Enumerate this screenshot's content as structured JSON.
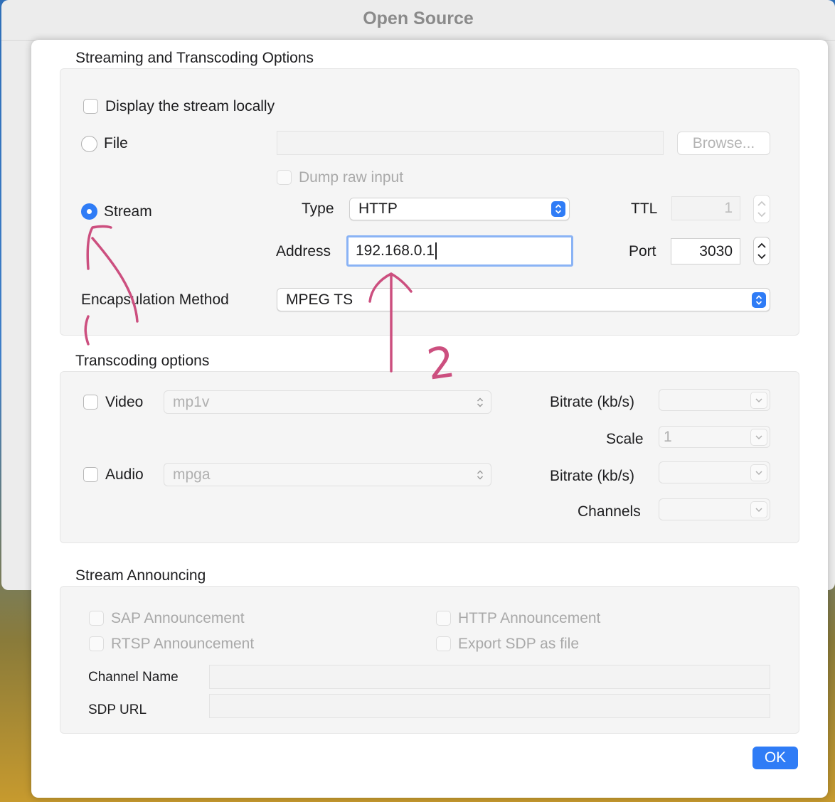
{
  "window": {
    "title": "Open Source"
  },
  "streaming": {
    "section_title": "Streaming and Transcoding Options",
    "display_locally_label": "Display the stream locally",
    "file_label": "File",
    "file_path": "",
    "browse_label": "Browse...",
    "dump_raw_label": "Dump raw input",
    "stream_label": "Stream",
    "type_label": "Type",
    "type_value": "HTTP",
    "ttl_label": "TTL",
    "ttl_value": "1",
    "address_label": "Address",
    "address_value": "192.168.0.1",
    "port_label": "Port",
    "port_value": "3030",
    "encapsulation_label": "Encapsulation Method",
    "encapsulation_value": "MPEG TS"
  },
  "transcoding": {
    "section_title": "Transcoding options",
    "video_label": "Video",
    "video_codec": "mp1v",
    "audio_label": "Audio",
    "audio_codec": "mpga",
    "video_bitrate_label": "Bitrate (kb/s)",
    "video_bitrate_value": "",
    "scale_label": "Scale",
    "scale_value": "1",
    "audio_bitrate_label": "Bitrate (kb/s)",
    "audio_bitrate_value": "",
    "channels_label": "Channels",
    "channels_value": ""
  },
  "announcing": {
    "section_title": "Stream Announcing",
    "sap_label": "SAP Announcement",
    "rtsp_label": "RTSP Announcement",
    "http_label": "HTTP Announcement",
    "export_sdp_label": "Export SDP as file",
    "channel_name_label": "Channel Name",
    "channel_name_value": "",
    "sdp_url_label": "SDP URL",
    "sdp_url_value": ""
  },
  "footer": {
    "ok_label": "OK"
  },
  "annotation": {
    "number_label": "2",
    "color": "#cc4f7f"
  },
  "colors": {
    "accent": "#2f7cf6",
    "focus_ring": "#8ab3f5"
  }
}
